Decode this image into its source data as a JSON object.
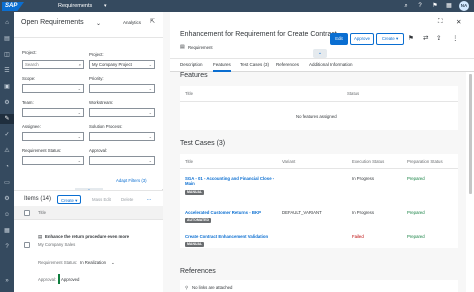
{
  "shell": {
    "logo": "SAP",
    "app_title": "Requirements",
    "avatar": "NA"
  },
  "list": {
    "title": "Open Requirements",
    "analytics": "Analytics",
    "filters": {
      "search_placeholder": "Search",
      "project_label": "Project:",
      "project_value": "My Company Project",
      "scope_label": "Scope:",
      "priority_label": "Priority:",
      "team_label": "Team:",
      "workstream_label": "Workstream:",
      "assignee_label": "Assignee:",
      "solution_process_label": "Solution Process:",
      "requirement_status_label": "Requirement Status:",
      "approval_label": "Approval:",
      "adapt_filters": "Adapt Filters (3)"
    },
    "items_title": "Items (14)",
    "buttons": {
      "create": "Create",
      "mass_edit": "Mass Edit",
      "delete": "Delete"
    },
    "col_title": "Title",
    "row": {
      "title": "Enhance the return procedure even more",
      "subtitle": "My Company Sales",
      "status_label": "Requirement Status:",
      "status_value": "In Realization",
      "approval_label": "Approval:",
      "approval_value": "Approved"
    }
  },
  "object": {
    "title": "Enhancement for Requirement for Create Contract",
    "type": "Requirement",
    "buttons": {
      "edit": "Edit",
      "approve": "Approve",
      "create": "Create"
    },
    "tabs": [
      "Description",
      "Features",
      "Test Cases (3)",
      "References",
      "Additional Information"
    ],
    "features": {
      "title": "Features",
      "col_title": "Title",
      "col_status": "Status",
      "empty": "No features assigned"
    },
    "test_cases": {
      "title": "Test Cases (3)",
      "col_title": "Title",
      "col_variant": "Variant",
      "col_exec": "Execution Status",
      "col_prep": "Preparation Status",
      "rows": [
        {
          "title": "SGA - 01 - Accounting and Financial Close - Main",
          "tag": "MANUAL",
          "variant": "",
          "exec": "In Progress",
          "prep": "Prepared"
        },
        {
          "title": "Accelerated Customer Returns - BKP",
          "tag": "AUTOMATED",
          "variant": "DEFAULT_VARIANT",
          "exec": "In Progress",
          "prep": "Prepared"
        },
        {
          "title": "Create Contract Enhancement Validation",
          "tag": "MANUAL",
          "variant": "",
          "exec": "Failed",
          "prep": "Prepared"
        }
      ]
    },
    "references": {
      "title": "References",
      "empty": "No links are attached"
    }
  }
}
